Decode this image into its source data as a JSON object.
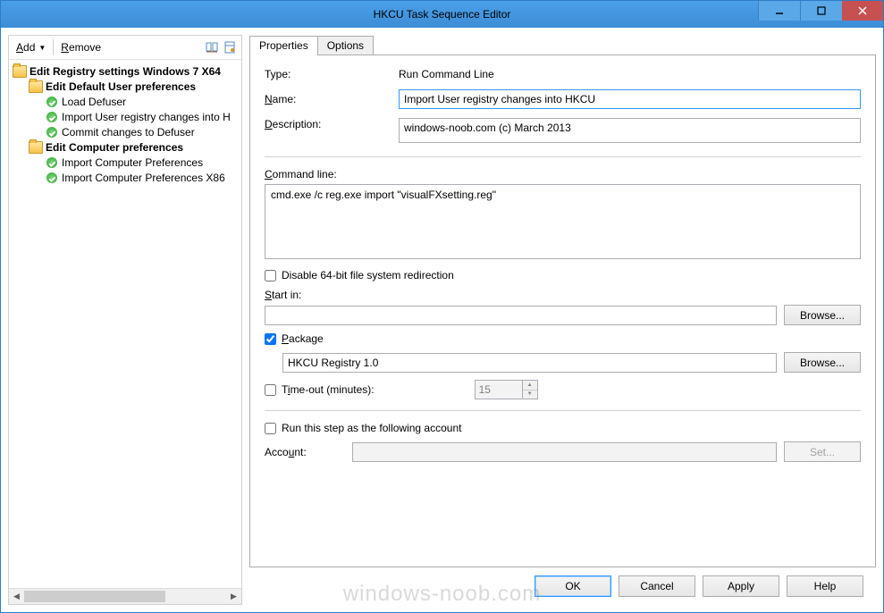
{
  "window": {
    "title": "HKCU Task Sequence Editor"
  },
  "toolbar": {
    "add": "Add",
    "remove": "Remove"
  },
  "tree": {
    "root": "Edit Registry settings Windows 7 X64",
    "group1": "Edit Default User preferences",
    "g1_items": [
      "Load Defuser",
      "Import User registry changes into H",
      "Commit changes to Defuser"
    ],
    "group2": "Edit Computer preferences",
    "g2_items": [
      "Import Computer Preferences",
      "Import Computer Preferences X86"
    ]
  },
  "tabs": {
    "properties": "Properties",
    "options": "Options"
  },
  "form": {
    "type_label": "Type:",
    "type_value": "Run Command Line",
    "name_label": "Name:",
    "name_value": "Import User registry changes into HKCU",
    "description_label": "Description:",
    "description_value": "windows-noob.com (c) March 2013",
    "commandline_label": "Command line:",
    "commandline_value": "cmd.exe /c reg.exe import \"visualFXsetting.reg\"",
    "disable64_label": "Disable 64-bit file system redirection",
    "disable64_checked": false,
    "startin_label": "Start in:",
    "startin_value": "",
    "browse1": "Browse...",
    "package_label": "Package",
    "package_checked": true,
    "package_value": "HKCU Registry 1.0",
    "browse2": "Browse...",
    "timeout_label": "Time-out (minutes):",
    "timeout_checked": false,
    "timeout_value": "15",
    "runas_label": "Run this step as the following account",
    "runas_checked": false,
    "account_label": "Account:",
    "account_value": "",
    "set_btn": "Set..."
  },
  "buttons": {
    "ok": "OK",
    "cancel": "Cancel",
    "apply": "Apply",
    "help": "Help"
  },
  "watermark": "windows-noob.com"
}
